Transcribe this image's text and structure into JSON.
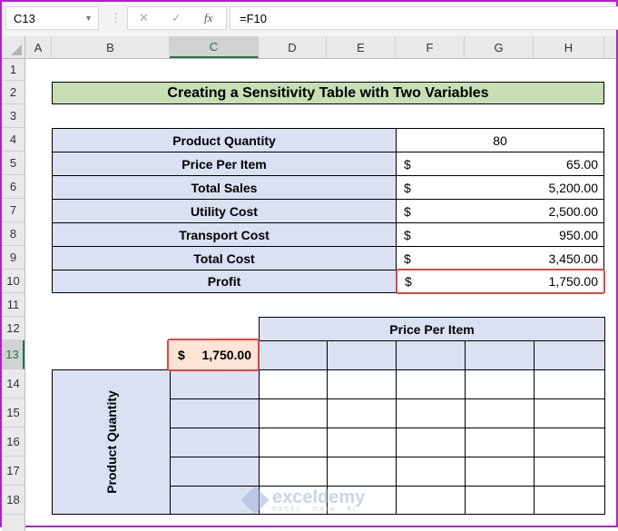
{
  "formula_bar": {
    "name_box": "C13",
    "cancel_icon": "✕",
    "enter_icon": "✓",
    "fx_label": "fx",
    "formula": "=F10"
  },
  "columns": [
    "A",
    "B",
    "C",
    "D",
    "E",
    "F",
    "G",
    "H"
  ],
  "rows": [
    "1",
    "2",
    "3",
    "4",
    "5",
    "6",
    "7",
    "8",
    "9",
    "10",
    "11",
    "12",
    "13",
    "14",
    "15",
    "16",
    "17",
    "18"
  ],
  "title": "Creating a Sensitivity Table with Two Variables",
  "inputs": [
    {
      "label": "Product Quantity",
      "currency": "",
      "value": "80"
    },
    {
      "label": "Price Per Item",
      "currency": "$",
      "value": "65.00"
    },
    {
      "label": "Total Sales",
      "currency": "$",
      "value": "5,200.00"
    },
    {
      "label": "Utility Cost",
      "currency": "$",
      "value": "2,500.00"
    },
    {
      "label": "Transport Cost",
      "currency": "$",
      "value": "950.00"
    },
    {
      "label": "Total Cost",
      "currency": "$",
      "value": "3,450.00"
    },
    {
      "label": "Profit",
      "currency": "$",
      "value": "1,750.00"
    }
  ],
  "sensitivity": {
    "col_header": "Price Per Item",
    "row_header": "Product Quantity",
    "corner_currency": "$",
    "corner_value": "1,750.00"
  },
  "watermark": {
    "name": "exceldemy",
    "tagline": "EXCEL · DATA · BI"
  }
}
